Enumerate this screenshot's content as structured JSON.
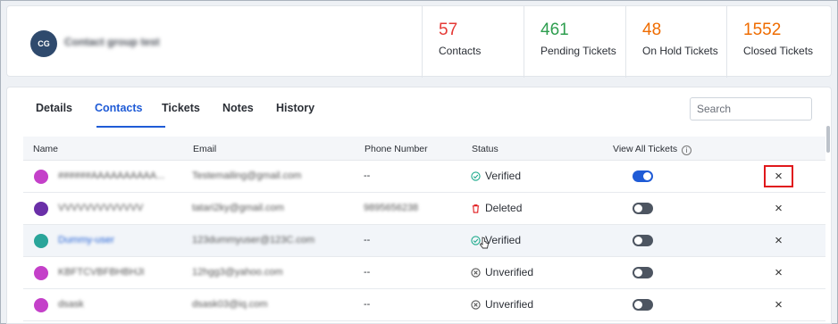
{
  "header": {
    "group_initials": "CG",
    "group_name": "Contact group test",
    "stats": [
      {
        "value": "57",
        "label": "Contacts",
        "color": "#e53935"
      },
      {
        "value": "461",
        "label": "Pending Tickets",
        "color": "#2e9e4f"
      },
      {
        "value": "48",
        "label": "On Hold Tickets",
        "color": "#ef6c00"
      },
      {
        "value": "1552",
        "label": "Closed Tickets",
        "color": "#ef6c00"
      }
    ]
  },
  "tabs": [
    "Details",
    "Contacts",
    "Tickets",
    "Notes",
    "History"
  ],
  "active_tab": "Contacts",
  "search": {
    "placeholder": "Search"
  },
  "table": {
    "columns": [
      "Name",
      "Email",
      "Phone Number",
      "Status",
      "View All Tickets"
    ],
    "rows": [
      {
        "name": "######AAAAAAAAAA...",
        "email": "Testemailing@gmail.com",
        "phone": "--",
        "status": "Verified",
        "status_icon": "check-circle-icon",
        "view_all_tickets": true,
        "avatar_color": "#c440c9"
      },
      {
        "name": "VVVVVVVVVVVVV",
        "email": "tatari2ky@gmail.com",
        "phone": "9895656238",
        "status": "Deleted",
        "status_icon": "trash-icon",
        "view_all_tickets": false,
        "avatar_color": "#6a2fa8"
      },
      {
        "name": "Dummy-user",
        "email": "123dummyuser@123C.com",
        "phone": "--",
        "status": "Verified",
        "status_icon": "check-circle-icon",
        "view_all_tickets": false,
        "avatar_color": "#2aa59a"
      },
      {
        "name": "KBFTCVBFBHBHJI",
        "email": "12hgg3@yahoo.com",
        "phone": "--",
        "status": "Unverified",
        "status_icon": "x-circle-icon",
        "view_all_tickets": false,
        "avatar_color": "#c440c9"
      },
      {
        "name": "dsask",
        "email": "dsask03@iq.com",
        "phone": "--",
        "status": "Unverified",
        "status_icon": "x-circle-icon",
        "view_all_tickets": false,
        "avatar_color": "#c440c9"
      }
    ],
    "remove_glyph": "×"
  }
}
